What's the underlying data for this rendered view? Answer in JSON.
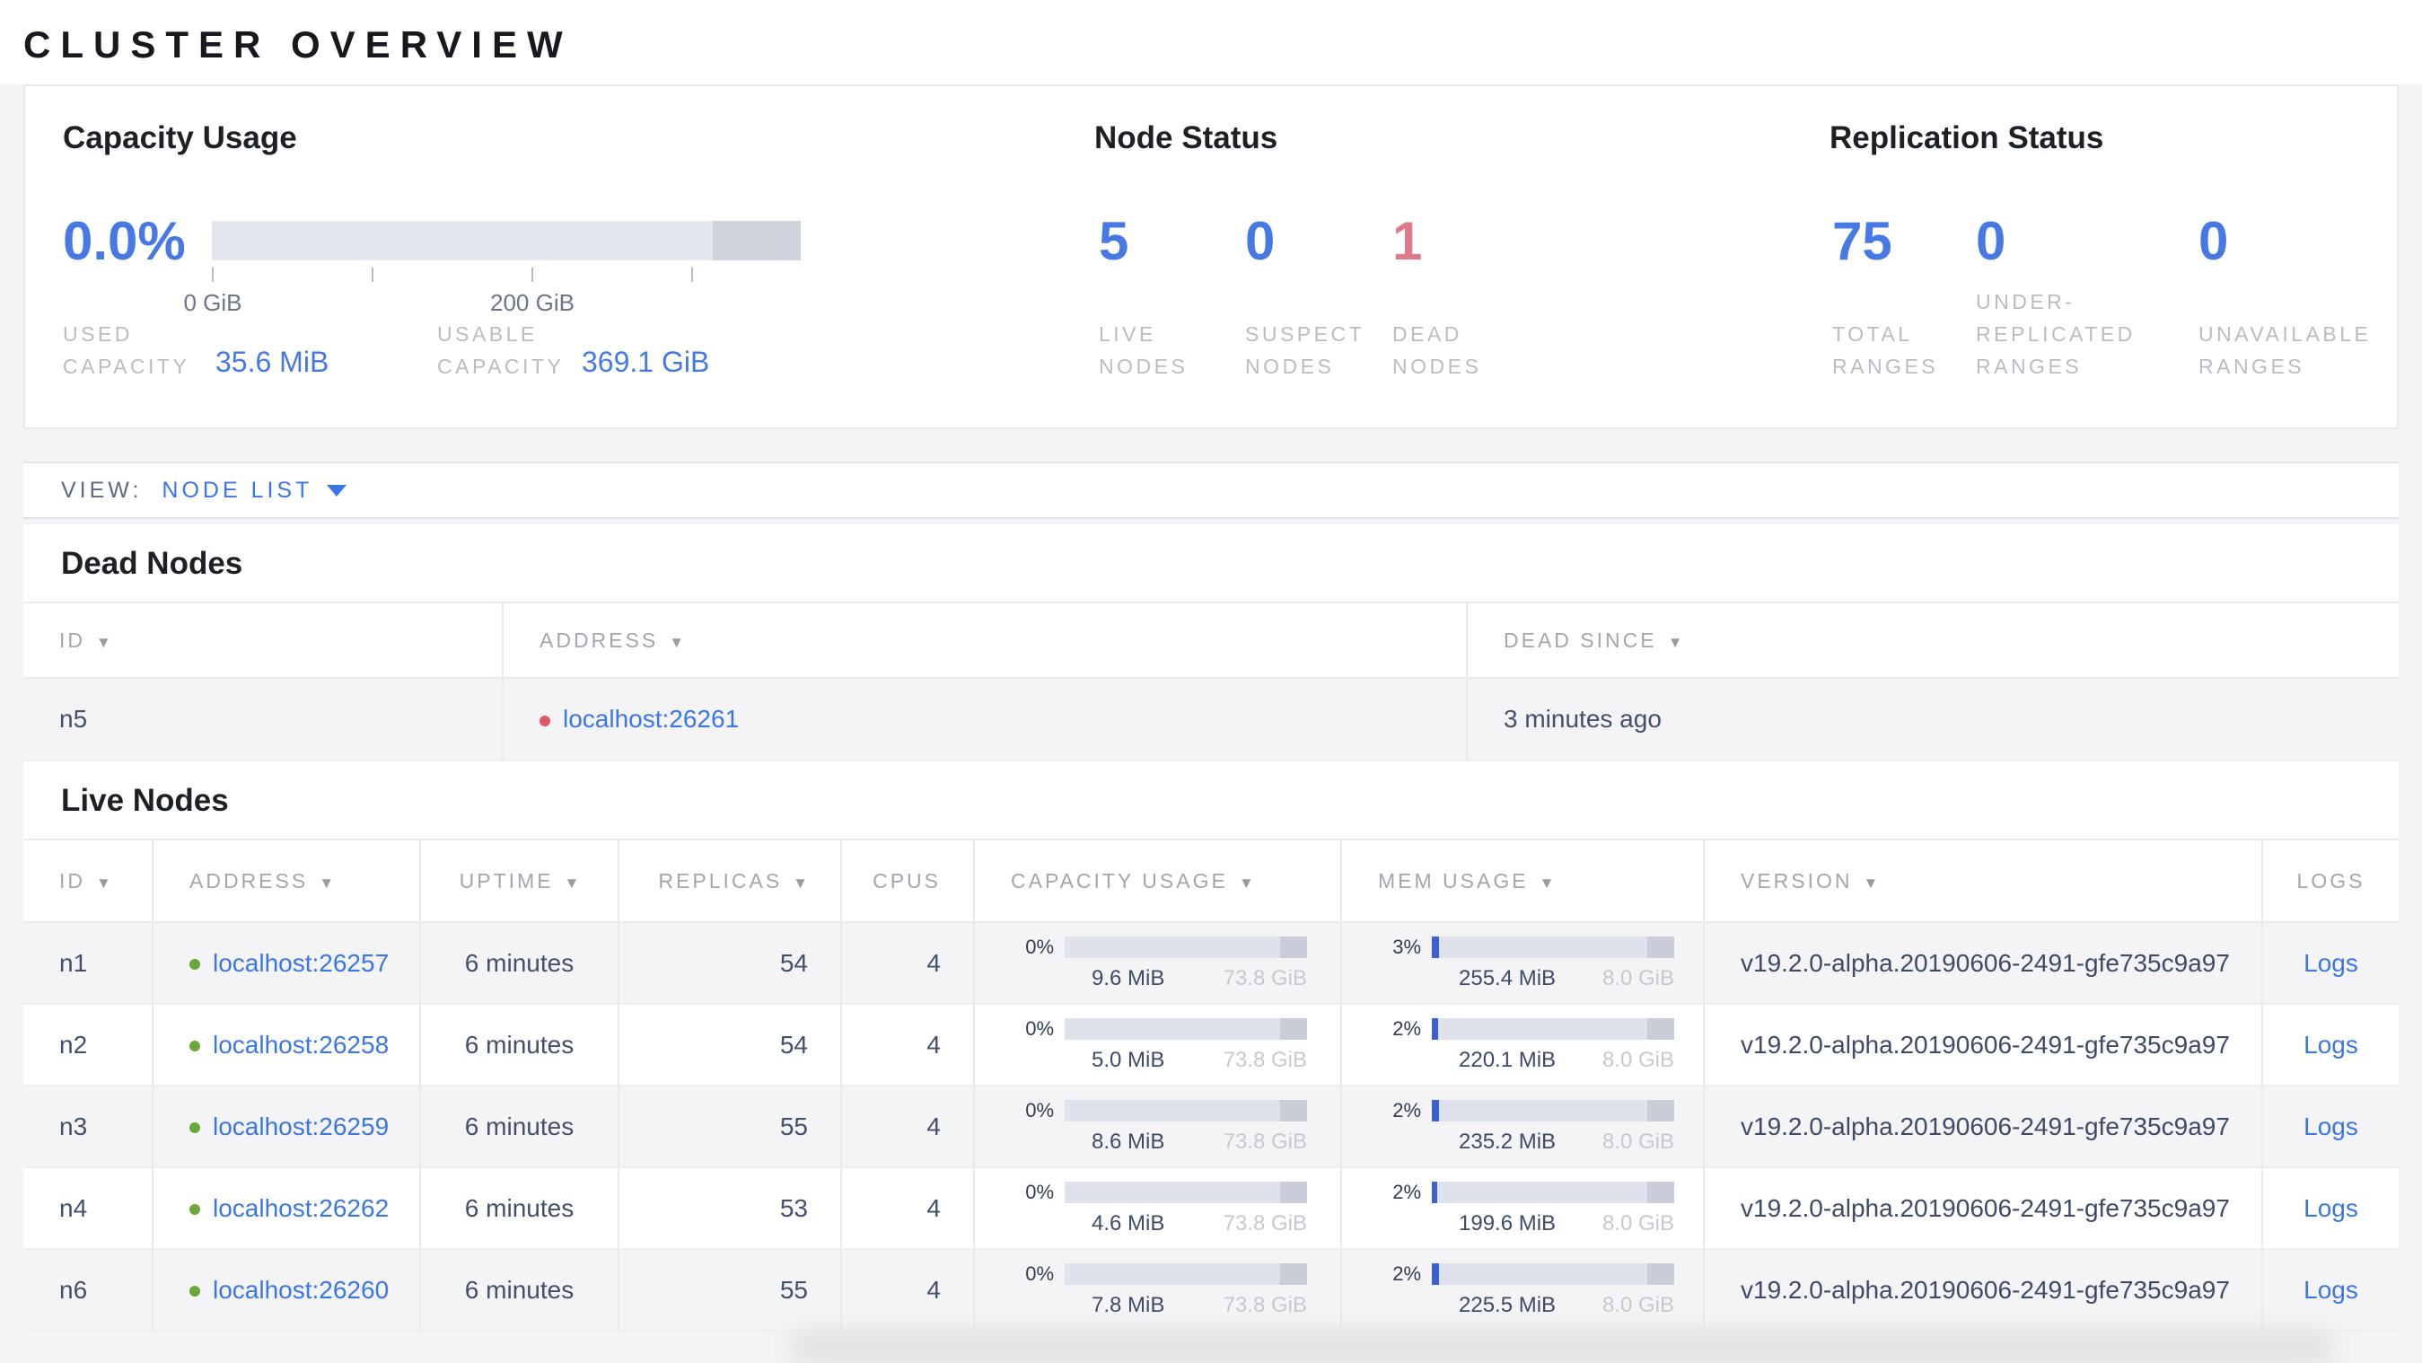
{
  "page": {
    "title": "CLUSTER OVERVIEW"
  },
  "colors": {
    "accent_blue": "#4679e3",
    "link_blue": "#3b77e4",
    "danger_red": "#e0798a",
    "dead_dot_red": "#df5866",
    "live_dot_green": "#6aa839",
    "bar_track": "#e4e6ed",
    "bar_segment": "#ced2db",
    "mem_fill_blue": "#3b5fd7"
  },
  "summary": {
    "capacity_usage": {
      "title": "Capacity Usage",
      "percent": "0.0%",
      "axis_ticks": [
        "0 GiB",
        "200 GiB"
      ],
      "used_capacity": {
        "label": "USED CAPACITY",
        "value": "35.6 MiB"
      },
      "usable_capacity": {
        "label": "USABLE CAPACITY",
        "value": "369.1 GiB"
      }
    },
    "node_status": {
      "title": "Node Status",
      "stats": [
        {
          "value": "5",
          "label": "LIVE NODES"
        },
        {
          "value": "0",
          "label": "SUSPECT NODES"
        },
        {
          "value": "1",
          "label": "DEAD NODES"
        }
      ]
    },
    "replication_status": {
      "title": "Replication Status",
      "stats": [
        {
          "value": "75",
          "label": "TOTAL RANGES"
        },
        {
          "value": "0",
          "label": "UNDER-REPLICATED RANGES"
        },
        {
          "value": "0",
          "label": "UNAVAILABLE RANGES"
        }
      ]
    }
  },
  "view_bar": {
    "label": "VIEW:",
    "selected": "NODE LIST"
  },
  "dead_nodes": {
    "title": "Dead Nodes",
    "columns": [
      "ID",
      "ADDRESS",
      "DEAD SINCE"
    ],
    "rows": [
      {
        "id": "n5",
        "address": "localhost:26261",
        "dead_since": "3 minutes ago"
      }
    ]
  },
  "live_nodes": {
    "title": "Live Nodes",
    "columns": [
      "ID",
      "ADDRESS",
      "UPTIME",
      "REPLICAS",
      "CPUS",
      "CAPACITY USAGE",
      "MEM USAGE",
      "VERSION",
      "LOGS"
    ],
    "rows": [
      {
        "id": "n1",
        "address": "localhost:26257",
        "uptime": "6 minutes",
        "replicas": "54",
        "cpus": "4",
        "capacity": {
          "percent": "0%",
          "fill": 0,
          "used": "9.6 MiB",
          "total": "73.8 GiB"
        },
        "memory": {
          "percent": "3%",
          "fill": 3,
          "used": "255.4 MiB",
          "total": "8.0 GiB"
        },
        "version": "v19.2.0-alpha.20190606-2491-gfe735c9a97",
        "logs_label": "Logs"
      },
      {
        "id": "n2",
        "address": "localhost:26258",
        "uptime": "6 minutes",
        "replicas": "54",
        "cpus": "4",
        "capacity": {
          "percent": "0%",
          "fill": 0,
          "used": "5.0 MiB",
          "total": "73.8 GiB"
        },
        "memory": {
          "percent": "2%",
          "fill": 2.7,
          "used": "220.1 MiB",
          "total": "8.0 GiB"
        },
        "version": "v19.2.0-alpha.20190606-2491-gfe735c9a97",
        "logs_label": "Logs"
      },
      {
        "id": "n3",
        "address": "localhost:26259",
        "uptime": "6 minutes",
        "replicas": "55",
        "cpus": "4",
        "capacity": {
          "percent": "0%",
          "fill": 0,
          "used": "8.6 MiB",
          "total": "73.8 GiB"
        },
        "memory": {
          "percent": "2%",
          "fill": 2.9,
          "used": "235.2 MiB",
          "total": "8.0 GiB"
        },
        "version": "v19.2.0-alpha.20190606-2491-gfe735c9a97",
        "logs_label": "Logs"
      },
      {
        "id": "n4",
        "address": "localhost:26262",
        "uptime": "6 minutes",
        "replicas": "53",
        "cpus": "4",
        "capacity": {
          "percent": "0%",
          "fill": 0,
          "used": "4.6 MiB",
          "total": "73.8 GiB"
        },
        "memory": {
          "percent": "2%",
          "fill": 2.4,
          "used": "199.6 MiB",
          "total": "8.0 GiB"
        },
        "version": "v19.2.0-alpha.20190606-2491-gfe735c9a97",
        "logs_label": "Logs"
      },
      {
        "id": "n6",
        "address": "localhost:26260",
        "uptime": "6 minutes",
        "replicas": "55",
        "cpus": "4",
        "capacity": {
          "percent": "0%",
          "fill": 0,
          "used": "7.8 MiB",
          "total": "73.8 GiB"
        },
        "memory": {
          "percent": "2%",
          "fill": 2.8,
          "used": "225.5 MiB",
          "total": "8.0 GiB"
        },
        "version": "v19.2.0-alpha.20190606-2491-gfe735c9a97",
        "logs_label": "Logs"
      }
    ]
  }
}
